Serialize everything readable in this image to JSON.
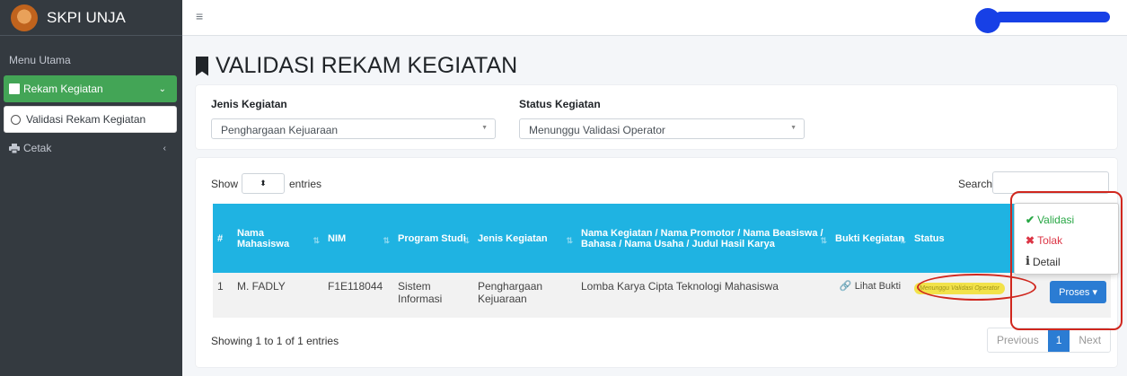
{
  "brand": {
    "name": "SKPI UNJA"
  },
  "sidebar": {
    "header": "Menu Utama",
    "items": [
      {
        "label": "Rekam Kegiatan",
        "icon": "book-icon",
        "caret": "⌄"
      },
      {
        "label": "Validasi Rekam Kegiatan",
        "icon": "circle-icon"
      },
      {
        "label": "Cetak",
        "icon": "print-icon",
        "caret": "‹"
      }
    ]
  },
  "topbar": {
    "menu_icon": "≡"
  },
  "page": {
    "title": "VALIDASI REKAM KEGIATAN"
  },
  "filters": {
    "jenis_label": "Jenis Kegiatan",
    "jenis_value": "Penghargaan Kejuaraan",
    "status_label": "Status Kegiatan",
    "status_value": "Menunggu Validasi Operator"
  },
  "table": {
    "show_label": "Show",
    "entries_label": "entries",
    "search_label": "Search:",
    "headers": [
      "#",
      "Nama Mahasiswa",
      "NIM",
      "Program Studi",
      "Jenis Kegiatan",
      "Nama Kegiatan / Nama Promotor / Nama Beasiswa / Bahasa / Nama Usaha / Judul Hasil Karya",
      "Bukti Kegiatan",
      "Status",
      ""
    ],
    "rows": [
      {
        "no": "1",
        "nama": "M. FADLY",
        "nim": "F1E118044",
        "prodi": "Sistem Informasi",
        "jenis": "Penghargaan Kejuaraan",
        "kegiatan": "Lomba Karya Cipta Teknologi Mahasiswa",
        "bukti": "Lihat Bukti",
        "status": "Menunggu Validasi Operator",
        "action": "Proses"
      }
    ],
    "info": "Showing 1 to 1 of 1 entries",
    "pagination": {
      "previous": "Previous",
      "current": "1",
      "next": "Next"
    }
  },
  "dropdown": {
    "items": [
      {
        "label": "Validasi",
        "icon": "check-icon",
        "color": "#28a745"
      },
      {
        "label": "Tolak",
        "icon": "x-icon",
        "color": "#dc3545"
      },
      {
        "label": "Detail",
        "icon": "info-icon",
        "color": "#333333"
      }
    ]
  },
  "colors": {
    "sidebar_bg": "#343a40",
    "active_menu": "#43a556",
    "table_header": "#1fb3e2",
    "primary": "#2b7cd3",
    "annotation": "#d0271e"
  }
}
